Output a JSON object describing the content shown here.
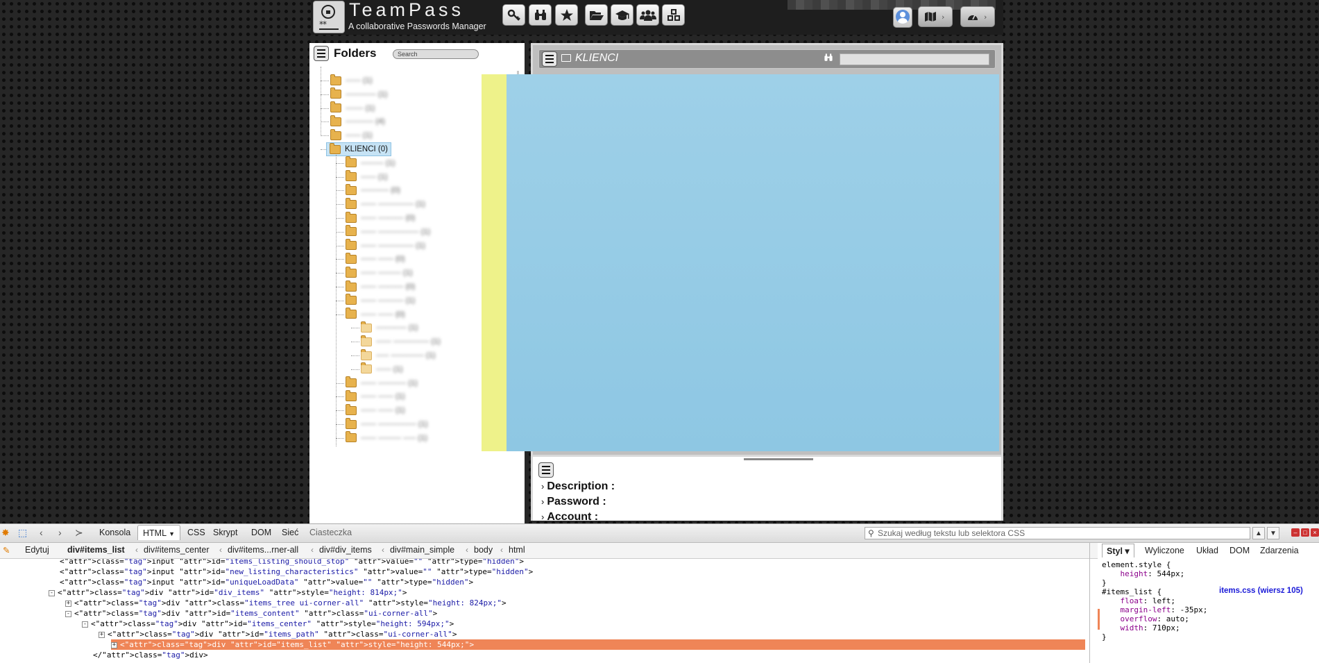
{
  "header": {
    "app_name": "TeamPass",
    "app_subtitle": "A collaborative Passwords Manager",
    "toolbar_icons": [
      "key-icon",
      "binoculars-icon",
      "star-icon",
      "folder-open-icon",
      "graduation-cap-icon",
      "users-icon",
      "cubes-icon"
    ],
    "toolbar_glyphs": [
      "⚷",
      "⚲",
      "★",
      "▱",
      "♜",
      "♟",
      "⬢"
    ]
  },
  "folders": {
    "title": "Folders",
    "search_placeholder": "Search",
    "selected_folder": "KLIENCI (0)",
    "blurred_items_top": [
      "------ (1)",
      "------------ (1)",
      "------- (1)",
      "----------- (4)",
      "------ (1)"
    ],
    "blurred_items_child": [
      "--------- (1)",
      "------ (1)",
      "----------- (0)",
      "------ -------------- (1)",
      "------ ---------- (0)",
      "------ ---------------- (1)",
      "------ -------------- (1)",
      "------ ------ (0)",
      "------ --------- (1)",
      "------ ---------- (0)",
      "------ ---------- (1)",
      "------ ------ (0)"
    ],
    "blurred_items_grandchild": [
      "------------ (1)",
      "------ -------------- (1)",
      "----- ------------- (1)",
      "------ (1)"
    ],
    "blurred_items_after": [
      "------ ----------- (1)",
      "------ ------ (1)",
      "------ ------ (1)",
      "------ --------------- (1)",
      "------ --------- ----- (1)"
    ]
  },
  "items": {
    "path": "KLIENCI",
    "search_value": ""
  },
  "details": {
    "fields": [
      "Description :",
      "Password :",
      "Account :"
    ]
  },
  "devtools": {
    "tabs": [
      "Konsola",
      "HTML",
      "CSS",
      "Skrypt",
      "DOM",
      "Sieć",
      "Ciasteczka"
    ],
    "active_tab": "HTML",
    "search_placeholder": "Szukaj według tekstu lub selektora CSS",
    "edit_label": "Edytuj",
    "breadcrumbs": [
      "div#items_list",
      "div#items_center",
      "div#items...rner-all",
      "div#div_items",
      "div#main_simple",
      "body",
      "html"
    ],
    "code_lines": [
      {
        "indent": 0,
        "text": "<input id=\"items_listing_should_stop\" value=\"\" type=\"hidden\">"
      },
      {
        "indent": 0,
        "text": "<input id=\"new_listing_characteristics\" value=\"\" type=\"hidden\">"
      },
      {
        "indent": 0,
        "text": "<input id=\"uniqueLoadData\" value=\"\" type=\"hidden\">"
      },
      {
        "indent": 0,
        "toggle": "-",
        "text": "<div id=\"div_items\" style=\"height: 814px;\">"
      },
      {
        "indent": 1,
        "toggle": "+",
        "text": "<div class=\"items_tree ui-corner-all\" style=\"height: 824px;\">"
      },
      {
        "indent": 1,
        "toggle": "-",
        "text": "<div id=\"items_content\" class=\"ui-corner-all\">"
      },
      {
        "indent": 2,
        "toggle": "-",
        "text": "<div id=\"items_center\" style=\"height: 594px;\">"
      },
      {
        "indent": 3,
        "toggle": "+",
        "text": "<div id=\"items_path\" class=\"ui-corner-all\">"
      },
      {
        "indent": 3,
        "toggle": "+",
        "text": "<div id=\"items_list\" style=\"height: 544px;\">",
        "selected": true
      },
      {
        "indent": 2,
        "text": "</div>"
      }
    ],
    "side_tabs": [
      "Styl",
      "Wyliczone",
      "Układ",
      "DOM",
      "Zdarzenia"
    ],
    "side_active": "Styl",
    "css_rules": [
      {
        "line": "element.style {"
      },
      {
        "line": "    height: 544px;"
      },
      {
        "line": "}"
      },
      {
        "line": "#items_list {",
        "source": "items.css (wiersz 105)"
      },
      {
        "line": "    float: left;"
      },
      {
        "line": "    margin-left: -35px;"
      },
      {
        "line": "    overflow: auto;"
      },
      {
        "line": "    width: 710px;"
      },
      {
        "line": "}"
      }
    ]
  }
}
